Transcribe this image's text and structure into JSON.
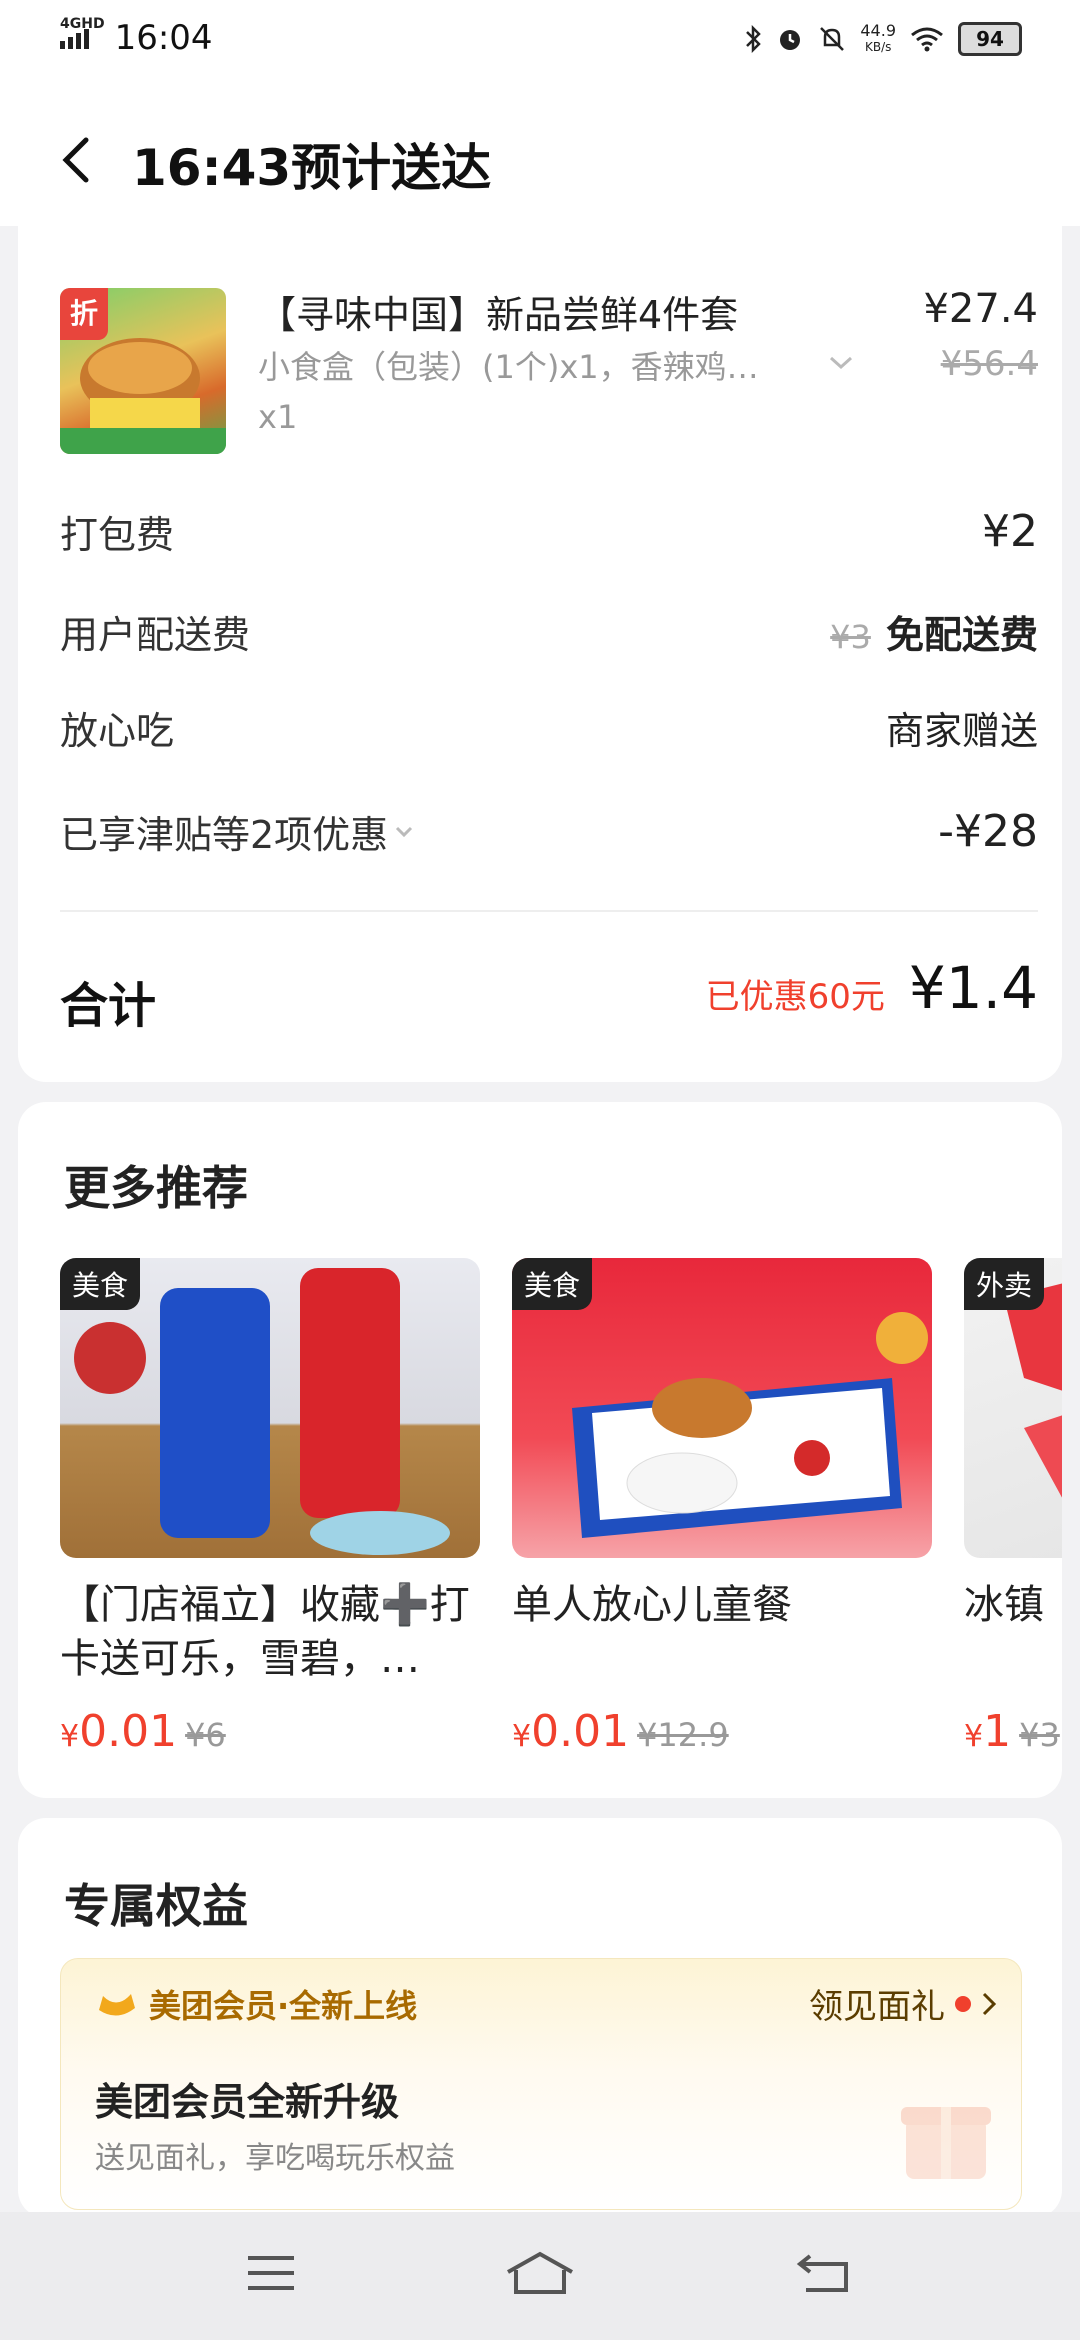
{
  "status_bar": {
    "network": "4GHD",
    "time": "16:04",
    "net_speed_value": "44.9",
    "net_speed_unit": "KB/s",
    "battery": "94"
  },
  "header": {
    "title": "16:43预计送达"
  },
  "order": {
    "product": {
      "tag": "折",
      "name": "【寻味中国】新品尝鲜4件套",
      "desc": "小食盒（包装）(1个)x1，香辣鸡…",
      "desc_qty": "x1",
      "price": "¥27.4",
      "original_price": "¥56.4"
    },
    "packing_fee": {
      "label": "打包费",
      "value": "¥2"
    },
    "delivery_fee": {
      "label": "用户配送费",
      "original": "¥3",
      "value": "免配送费"
    },
    "assurance": {
      "label": "放心吃",
      "value": "商家赠送"
    },
    "discounts": {
      "label": "已享津贴等2项优惠",
      "value": "-¥28"
    },
    "total": {
      "label": "合计",
      "saved": "已优惠60元",
      "value": "¥1.4"
    }
  },
  "recommend": {
    "title": "更多推荐",
    "items": [
      {
        "badge": "美食",
        "name": "【门店福立】收藏➕打卡送可乐，雪碧，…",
        "currency": "¥",
        "price": "0.01",
        "original": "¥6"
      },
      {
        "badge": "美食",
        "name": "单人放心儿童餐",
        "currency": "¥",
        "price": "0.01",
        "original": "¥12.9"
      },
      {
        "badge": "外卖",
        "name": "冰镇",
        "currency": "¥",
        "price": "1",
        "original": "¥3"
      }
    ]
  },
  "benefits": {
    "title": "专属权益",
    "brand": "美团会员·全新上线",
    "link": "领见面礼",
    "card_title": "美团会员全新升级",
    "card_sub": "送见面礼，享吃喝玩乐权益"
  },
  "colors": {
    "accent_red": "#f0402d",
    "vip_gold": "#a86a00"
  }
}
